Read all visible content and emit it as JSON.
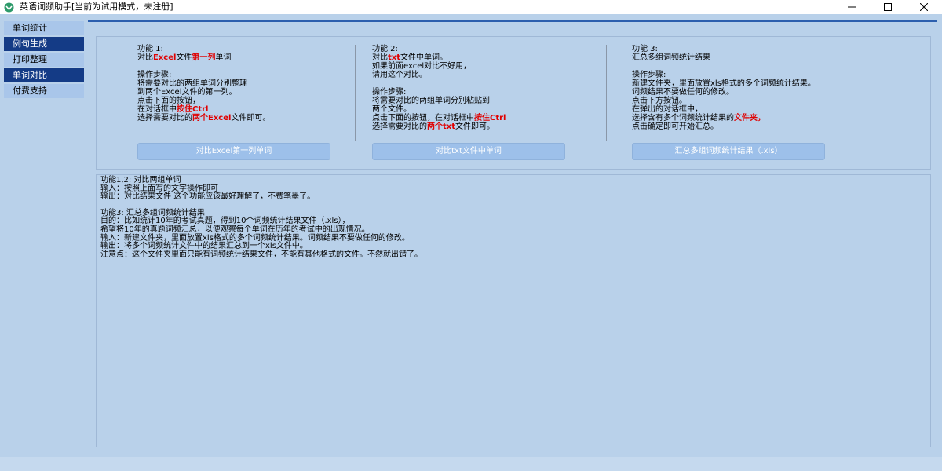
{
  "window": {
    "title": "英语词频助手[当前为试用模式，未注册]",
    "minimize": "—",
    "maximize": "☐",
    "close": "✕"
  },
  "sidebar": {
    "items": [
      {
        "label": "单词统计",
        "style": "light"
      },
      {
        "label": "例句生成",
        "style": "dark"
      },
      {
        "label": "打印整理",
        "style": "light"
      },
      {
        "label": "单词对比",
        "style": "dark"
      },
      {
        "label": "付费支持",
        "style": "light"
      }
    ]
  },
  "features": [
    {
      "title": "功能 1:",
      "desc": [
        {
          "t": "对比"
        },
        {
          "t": "Excel",
          "red": true
        },
        {
          "t": "文件"
        },
        {
          "t": "第一列",
          "red": true
        },
        {
          "t": "单词"
        }
      ],
      "steps_title": "操作步骤:",
      "steps": [
        [
          {
            "t": "将需要对比的两组单词分别整理"
          }
        ],
        [
          {
            "t": "到两个Excel文件的第一列。"
          }
        ],
        [
          {
            "t": "点击下面的按钮，"
          }
        ],
        [
          {
            "t": "在对话框中"
          },
          {
            "t": "按住Ctrl",
            "red": true
          }
        ],
        [
          {
            "t": "选择需要对比的"
          },
          {
            "t": "两个Excel",
            "red": true
          },
          {
            "t": "文件即可。"
          }
        ]
      ],
      "button": "对比Excel第一列单词"
    },
    {
      "title": "功能 2:",
      "desc": [
        {
          "t": "对比"
        },
        {
          "t": "txt",
          "red": true
        },
        {
          "t": "文件中单词。"
        }
      ],
      "desc_extra": [
        "如果前面excel对比不好用，",
        "请用这个对比。"
      ],
      "steps_title": "操作步骤:",
      "steps": [
        [
          {
            "t": "将需要对比的两组单词分别粘贴到"
          }
        ],
        [
          {
            "t": "两个文件。"
          }
        ],
        [
          {
            "t": "点击下面的按钮，在对话框中"
          },
          {
            "t": "按住Ctrl",
            "red": true
          }
        ],
        [
          {
            "t": "选择需要对比的"
          },
          {
            "t": "两个txt",
            "red": true
          },
          {
            "t": "文件即可。"
          }
        ]
      ],
      "button": "对比txt文件中单词"
    },
    {
      "title": "功能 3:",
      "desc": [
        {
          "t": "汇总多组词频统计结果"
        }
      ],
      "steps_title": "操作步骤:",
      "steps": [
        [
          {
            "t": "新建文件夹，里面放置xls格式的多个词频统计结果。"
          }
        ],
        [
          {
            "t": "词频结果不要做任何的修改。"
          }
        ],
        [
          {
            "t": "点击下方按钮。"
          }
        ],
        [
          {
            "t": "在弹出的对话框中，"
          }
        ],
        [
          {
            "t": "选择含有多个词频统计结果的"
          },
          {
            "t": "文件夹",
            "red": true
          },
          {
            "t": "，"
          }
        ],
        [
          {
            "t": "点击确定即可开始汇总。"
          }
        ]
      ],
      "button": "汇总多组词频统计结果（.xls）"
    }
  ],
  "info": {
    "lines": [
      "功能1,2: 对比两组单词",
      "输入：按照上面写的文字操作即可",
      "输出：对比结果文件  这个功能应该最好理解了，不费笔墨了。",
      "",
      "功能3: 汇总多组词频统计结果",
      "目的：比如统计10年的考试真题，得到10个词频统计结果文件（.xls），",
      "希望将10年的真题词频汇总，以便观察每个单词在历年的考试中的出现情况。",
      "输入：新建文件夹，里面放置xls格式的多个词频统计结果。词频结果不要做任何的修改。",
      "输出：将多个词频统计文件中的结果汇总到一个xls文件中。",
      "注意点：这个文件夹里面只能有词频统计结果文件，不能有其他格式的文件。不然就出错了。"
    ]
  },
  "colors": {
    "background": "#b9d1ea",
    "nav_dark": "#143b86",
    "nav_light": "#a9c6ea",
    "accent_red": "#e00000",
    "button": "#9dc0ea"
  }
}
